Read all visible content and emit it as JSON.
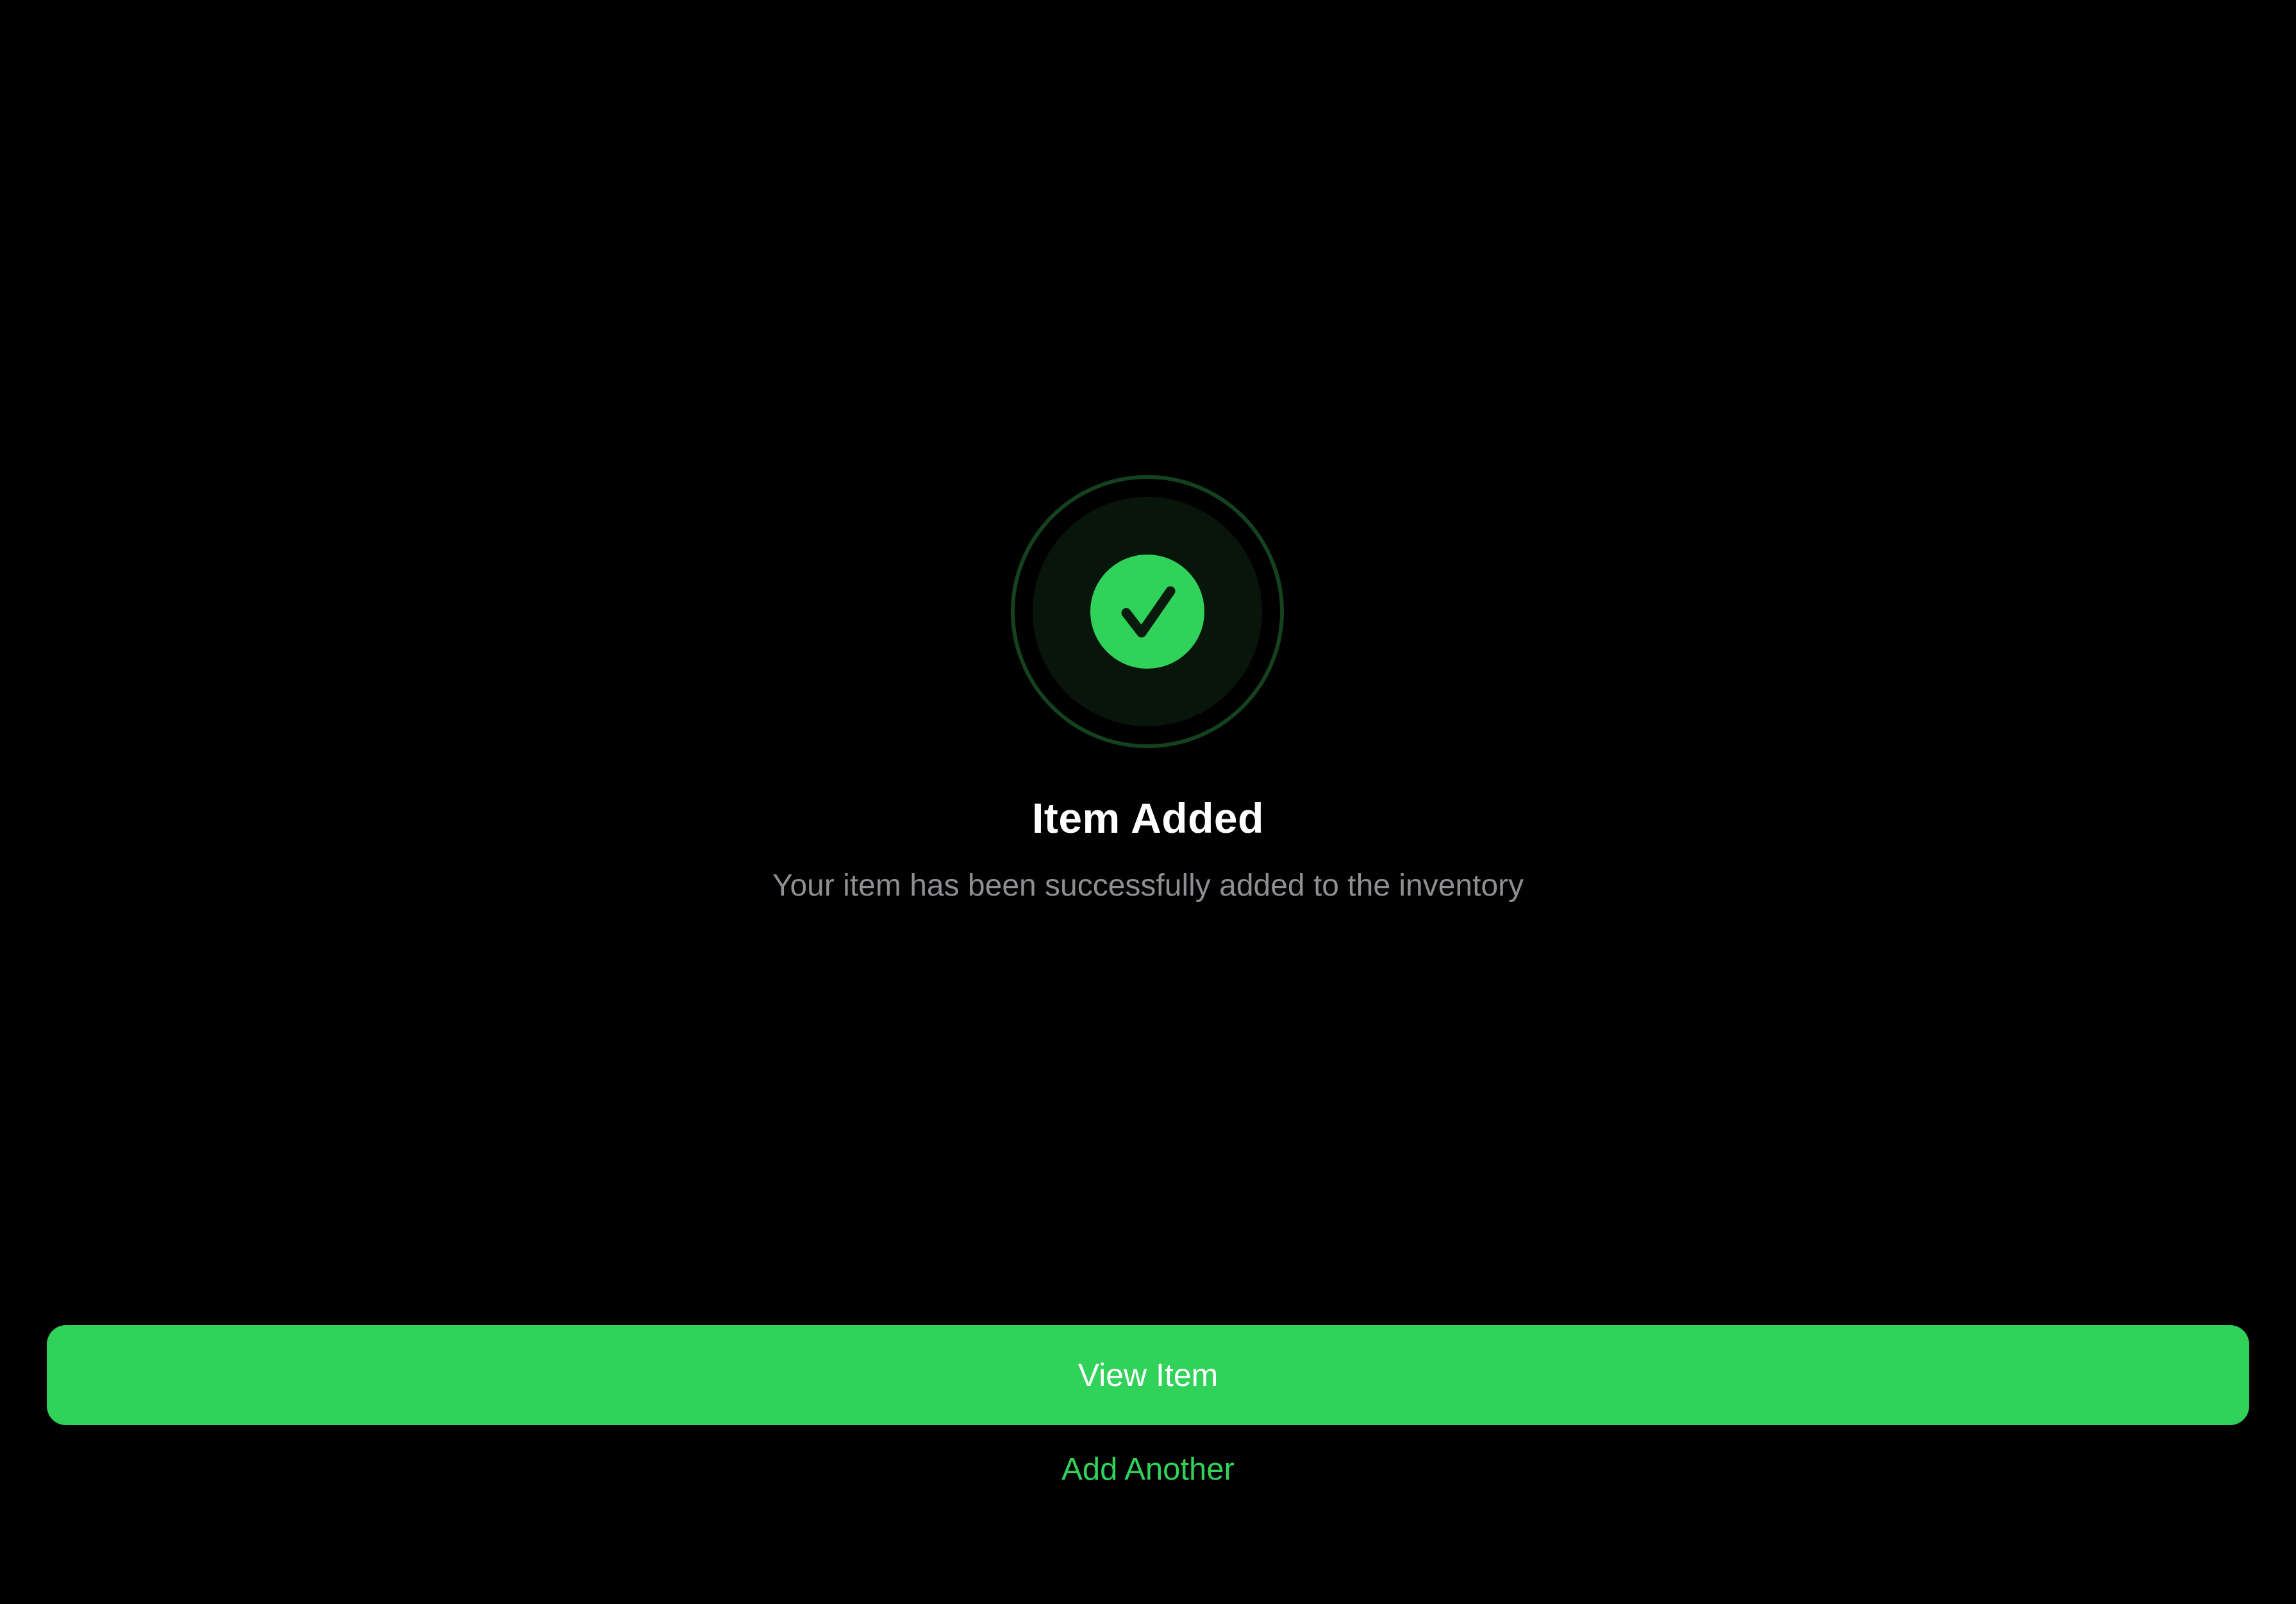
{
  "theme": {
    "background": "#000000",
    "accent": "#31d25a",
    "ring_border": "#14421e",
    "ring_fill": "#08150a",
    "title_color": "#ffffff",
    "subtitle_color": "#8e8e93"
  },
  "status": {
    "icon": "checkmark-icon",
    "title": "Item Added",
    "message": "Your item has been successfully added to the inventory"
  },
  "actions": {
    "primary_label": "View Item",
    "secondary_label": "Add Another"
  }
}
